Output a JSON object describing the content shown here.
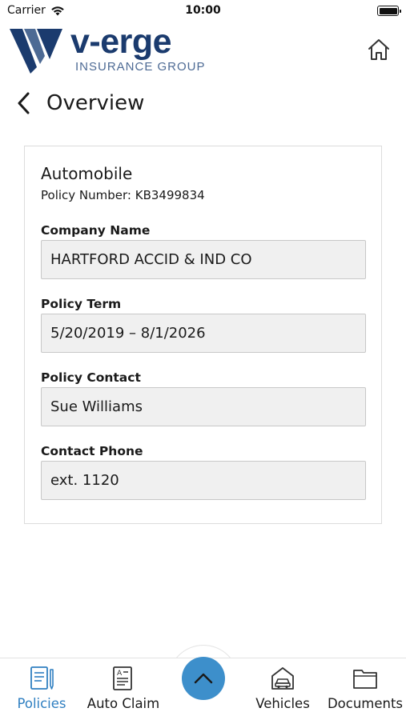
{
  "status_bar": {
    "carrier": "Carrier",
    "time": "10:00"
  },
  "header": {
    "logo_wordmark": "v-erge",
    "logo_subtitle": "INSURANCE GROUP",
    "brand_color": "#1b3b6e",
    "home_icon": "home-icon"
  },
  "nav": {
    "title": "Overview",
    "back_icon": "chevron-left-icon"
  },
  "policy": {
    "type": "Automobile",
    "number_text": "Policy Number: KB3499834",
    "fields": [
      {
        "label": "Company Name",
        "value": "HARTFORD ACCID & IND CO"
      },
      {
        "label": "Policy Term",
        "value": "5/20/2019 – 8/1/2026"
      },
      {
        "label": "Policy Contact",
        "value": "Sue Williams"
      },
      {
        "label": "Contact Phone",
        "value": "ext. 1120"
      }
    ]
  },
  "tab_bar": {
    "active_color": "#2f7fc1",
    "fab_color": "#3d8fcb",
    "fab_icon": "chevron-up-icon",
    "tabs": [
      {
        "label": "Policies",
        "icon": "policy-document-icon",
        "active": true
      },
      {
        "label": "Auto Claim",
        "icon": "claim-form-icon",
        "active": false
      },
      {
        "label": "Vehicles",
        "icon": "car-garage-icon",
        "active": false
      },
      {
        "label": "Documents",
        "icon": "folder-icon",
        "active": false
      }
    ]
  }
}
